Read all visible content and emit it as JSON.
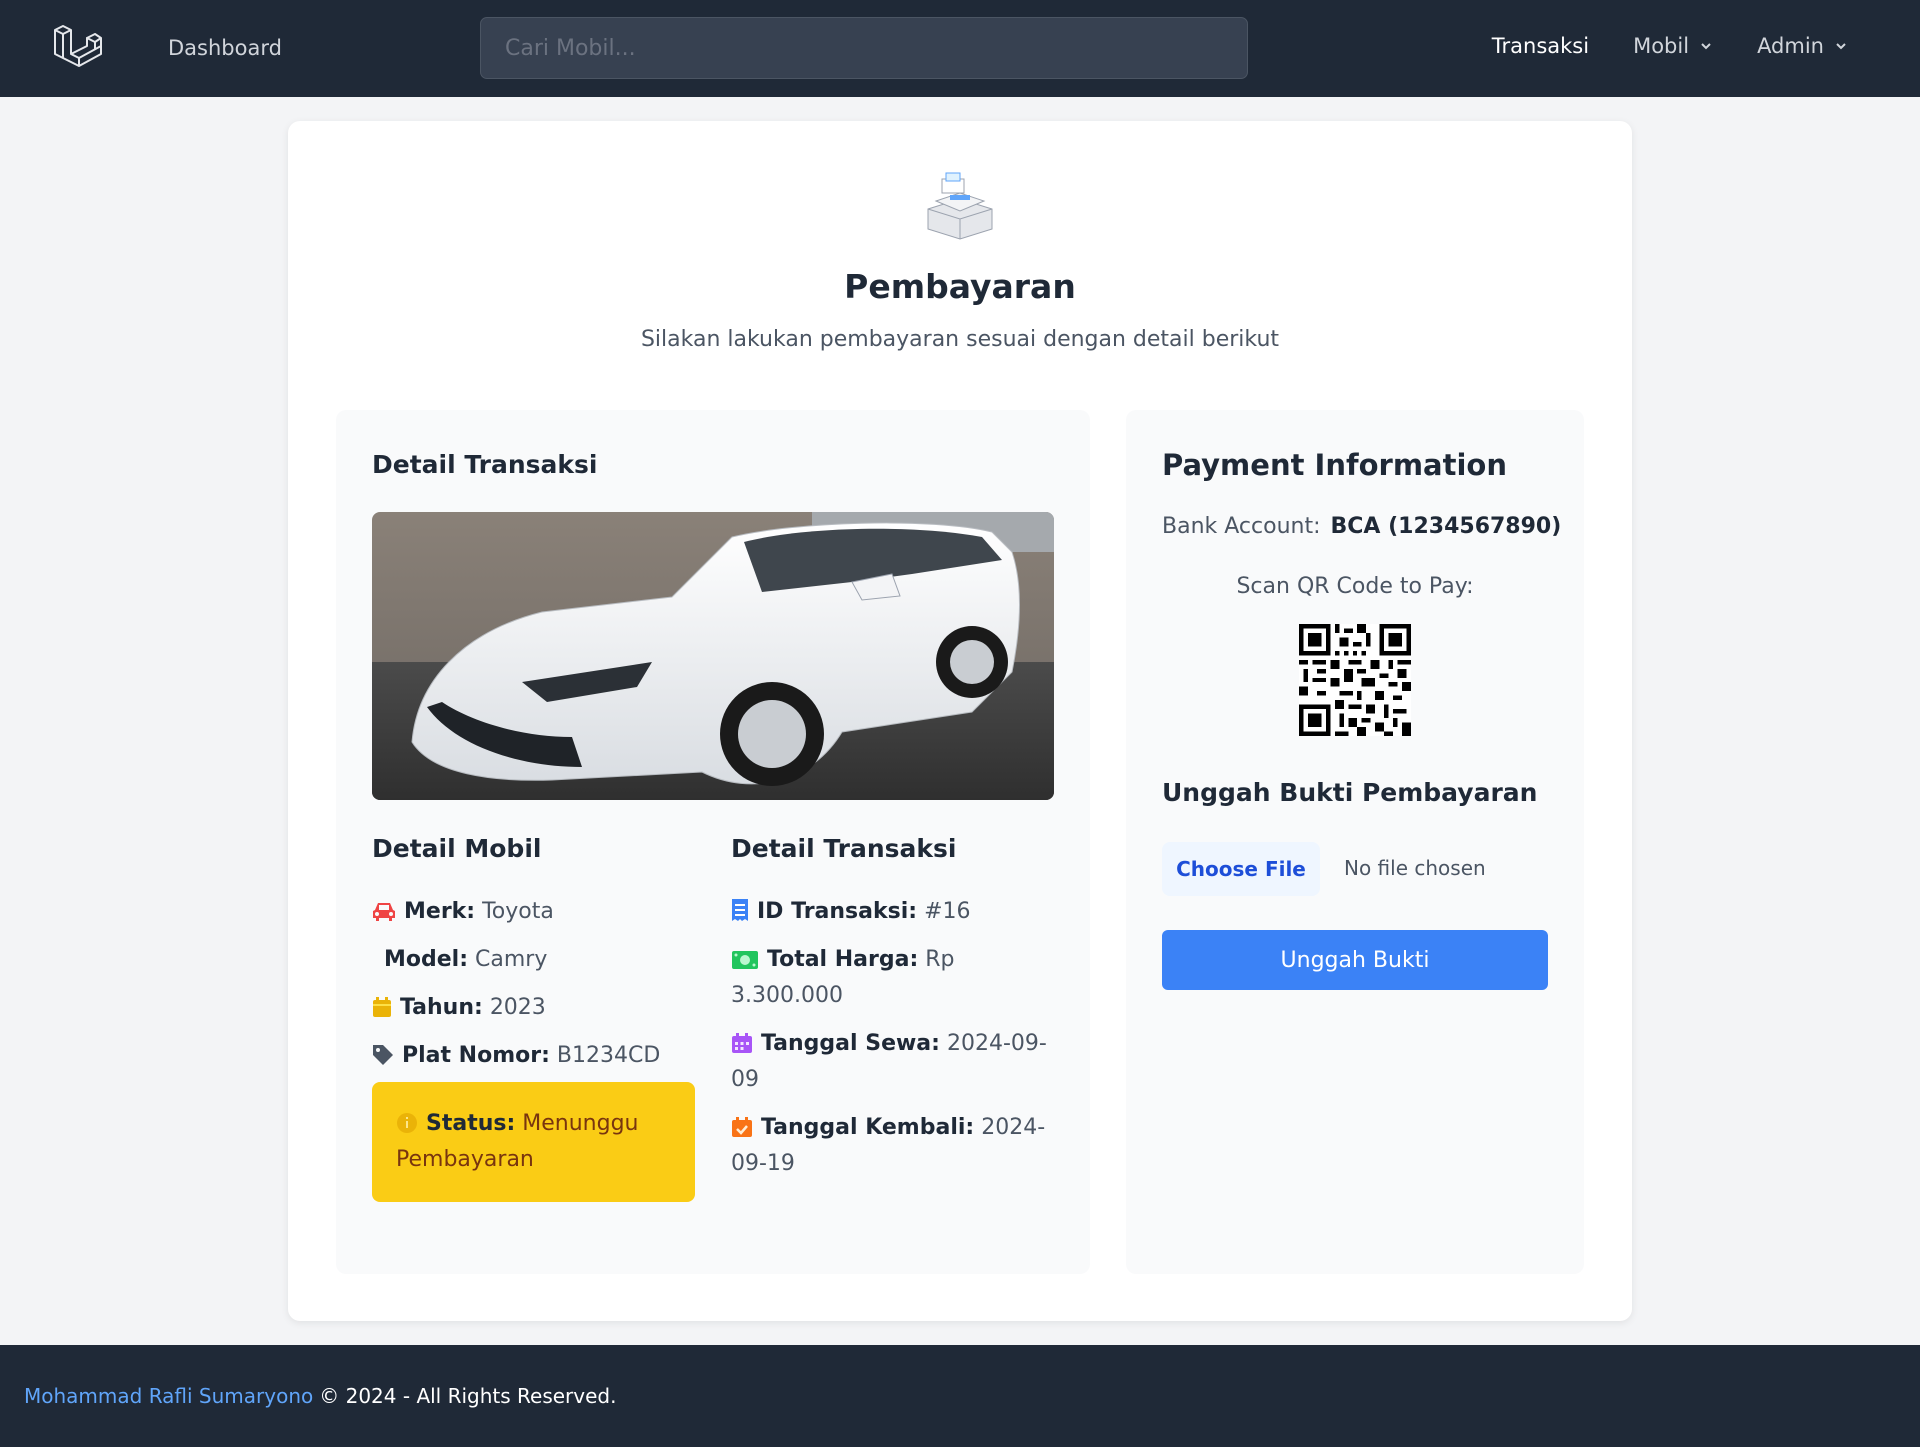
{
  "nav": {
    "dashboard": "Dashboard",
    "search_placeholder": "Cari Mobil...",
    "transaksi": "Transaksi",
    "mobil": "Mobil",
    "admin": "Admin"
  },
  "header": {
    "title": "Pembayaran",
    "subtitle": "Silakan lakukan pembayaran sesuai dengan detail berikut"
  },
  "detail": {
    "heading": "Detail Transaksi",
    "mobil": {
      "heading": "Detail Mobil",
      "merk_label": "Merk:",
      "merk": "Toyota",
      "model_label": "Model:",
      "model": "Camry",
      "tahun_label": "Tahun:",
      "tahun": "2023",
      "plat_label": "Plat Nomor:",
      "plat": "B1234CD",
      "status_label": "Status:",
      "status": "Menunggu Pembayaran"
    },
    "transaksi": {
      "heading": "Detail Transaksi",
      "id_label": "ID Transaksi:",
      "id": "#16",
      "harga_label": "Total Harga:",
      "harga": "Rp 3.300.000",
      "sewa_label": "Tanggal Sewa:",
      "sewa": "2024-09-09",
      "kembali_label": "Tanggal Kembali:",
      "kembali": "2024-09-19"
    }
  },
  "payment": {
    "title": "Payment Information",
    "bank_label": "Bank Account:",
    "bank": "BCA (1234567890)",
    "qr_label": "Scan QR Code to Pay:",
    "upload_title": "Unggah Bukti Pembayaran",
    "choose_file": "Choose File",
    "file_status": "No file chosen",
    "submit": "Unggah Bukti"
  },
  "footer": {
    "author": "Mohammad Rafli Sumaryono",
    "rights": "© 2024 - All Rights Reserved."
  },
  "colors": {
    "nav_bg": "#1f2937",
    "accent": "#3b82f6",
    "status_bg": "#facc15"
  },
  "icons": {
    "car": "car-icon",
    "calendar": "calendar-icon",
    "tag": "tag-icon",
    "receipt": "receipt-icon",
    "money": "money-icon",
    "calendar_check": "calendar-check-icon",
    "info": "info-icon"
  }
}
